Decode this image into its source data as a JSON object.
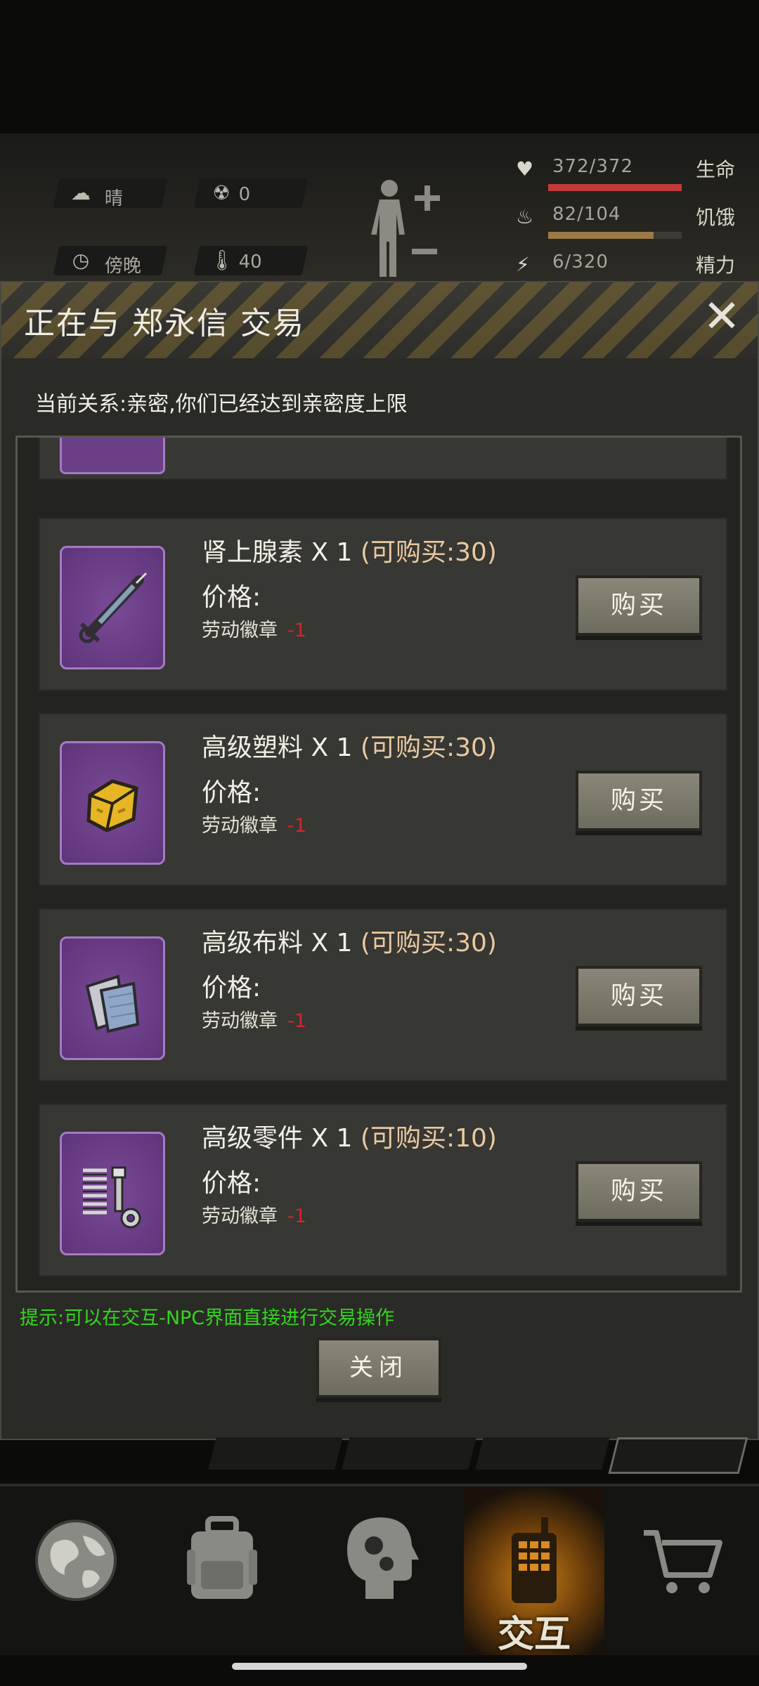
{
  "hud": {
    "weather": "晴",
    "radiation": "0",
    "time_of_day": "傍晚",
    "temperature": "40",
    "stats": [
      {
        "label": "生命",
        "value": "372/372",
        "color": "#c23a3a",
        "fraction": 1.0
      },
      {
        "label": "饥饿",
        "value": "82/104",
        "color": "#9a7a45",
        "fraction": 0.79
      },
      {
        "label": "精力",
        "value": "6/320",
        "color": "#8a8a82",
        "fraction": 0.02
      }
    ]
  },
  "dialog": {
    "title": "正在与 郑永信 交易",
    "close_icon": "close-icon",
    "relation": "当前关系:亲密,你们已经达到亲密度上限",
    "price_label": "价格:",
    "buy_label": "购买",
    "items": [
      {
        "name": "肾上腺素 X 1",
        "avail": "(可购买:30)",
        "currency": "劳动徽章",
        "cost": "-1",
        "icon": "syringe-icon"
      },
      {
        "name": "高级塑料 X 1",
        "avail": "(可购买:30)",
        "currency": "劳动徽章",
        "cost": "-1",
        "icon": "plastic-block-icon"
      },
      {
        "name": "高级布料 X 1",
        "avail": "(可购买:30)",
        "currency": "劳动徽章",
        "cost": "-1",
        "icon": "cloth-icon"
      },
      {
        "name": "高级零件 X 1",
        "avail": "(可购买:10)",
        "currency": "劳动徽章",
        "cost": "-1",
        "icon": "spring-bolt-icon"
      }
    ],
    "tip": "提示:可以在交互-NPC界面直接进行交易操作",
    "close_label": "关闭"
  },
  "bottom_nav": {
    "items": [
      {
        "icon": "globe-icon",
        "label": ""
      },
      {
        "icon": "backpack-icon",
        "label": ""
      },
      {
        "icon": "head-gears-icon",
        "label": ""
      },
      {
        "icon": "walkie-talkie-icon",
        "label": "交互",
        "active": true
      },
      {
        "icon": "cart-icon",
        "label": ""
      }
    ]
  }
}
